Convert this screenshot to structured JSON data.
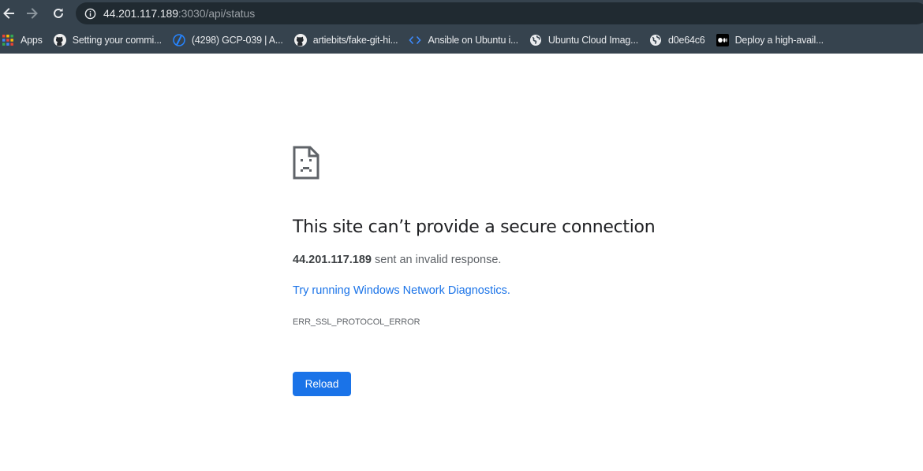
{
  "toolbar": {
    "url_host": "44.201.117.189",
    "url_path": ":3030/api/status"
  },
  "bookmarks": [
    {
      "label": "Apps",
      "icon": "apps-grid-icon"
    },
    {
      "label": "Setting your commi...",
      "icon": "github-icon"
    },
    {
      "label": "(4298) GCP-039 | A...",
      "icon": "blue-slash-icon"
    },
    {
      "label": "artiebits/fake-git-hi...",
      "icon": "github-icon"
    },
    {
      "label": "Ansible on Ubuntu i...",
      "icon": "code-brackets-icon"
    },
    {
      "label": "Ubuntu Cloud Imag...",
      "icon": "globe-icon"
    },
    {
      "label": "d0e64c6",
      "icon": "globe-icon"
    },
    {
      "label": "Deploy a high-avail...",
      "icon": "medium-icon"
    }
  ],
  "error": {
    "title": "This site can’t provide a secure connection",
    "host": "44.201.117.189",
    "summary_suffix": " sent an invalid response.",
    "diagnostics_link": "Try running Windows Network Diagnostics.",
    "code": "ERR_SSL_PROTOCOL_ERROR",
    "reload_label": "Reload"
  },
  "colors": {
    "chrome_frame": "#36434e",
    "omnibox": "#202a31",
    "link": "#1a73e8",
    "button": "#1a73e8"
  }
}
